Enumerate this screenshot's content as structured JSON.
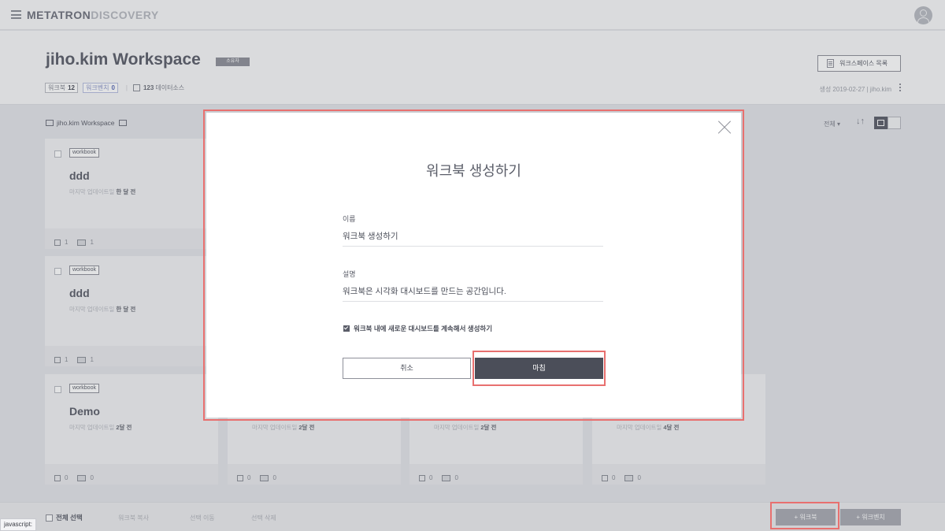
{
  "brand": {
    "main": "METATRON",
    "sub": "DISCOVERY"
  },
  "workspace": {
    "title": "jiho.kim Workspace",
    "owner_badge": "소유자",
    "workbook_label": "워크북",
    "workbook_count": "12",
    "workbench_label": "워크벤치",
    "workbench_count": "0",
    "datasource_count": "123",
    "datasource_label": "데이터소스",
    "list_button": "워크스페이스 목록",
    "created": "생성 2019-02-27 | jiho.kim"
  },
  "toolbar": {
    "breadcrumb": "jiho.kim Workspace",
    "filter": "전체",
    "filter_arrow": "▾",
    "sort_icon": "↓↑"
  },
  "cards": [
    {
      "tag": "workbook",
      "name": "ddd",
      "updated_label": "마지막 업데이트일",
      "updated_value": "한 달 전",
      "files": "1",
      "dashboards": "1"
    },
    {
      "tag": "workbook",
      "name": "ddd",
      "updated_label": "마지막 업데이트일",
      "updated_value": "한 달 전",
      "files": "1",
      "dashboards": "1"
    },
    {
      "tag": "workbook",
      "name": "Demo",
      "updated_label": "마지막 업데이트일",
      "updated_value": "2달 전",
      "files": "0",
      "dashboards": "0"
    },
    {
      "updated_label": "마지막 업데이트일",
      "updated_value": "2달 전",
      "files": "0",
      "dashboards": "0"
    },
    {
      "updated_label": "마지막 업데이트일",
      "updated_value": "2달 전",
      "files": "0",
      "dashboards": "0"
    },
    {
      "updated_label": "마지막 업데이트일",
      "updated_value": "4달 전",
      "files": "0",
      "dashboards": "0"
    }
  ],
  "bottom": {
    "select_all": "전체 선택",
    "copy": "워크북 복사",
    "move": "선택 이동",
    "delete": "선택 삭제",
    "add_workbook": "+ 워크북",
    "add_workbench": "+ 워크벤치"
  },
  "status_bar": "javascript:",
  "modal": {
    "title": "워크북 생성하기",
    "name_label": "이름",
    "name_value": "워크북 생성하기",
    "desc_label": "설명",
    "desc_value": "워크북은 시각화 대시보드를 만드는 공간입니다.",
    "checkbox_label": "워크북 내에 새로운 대시보드를 계속해서 생성하기",
    "checkbox_checked": true,
    "cancel": "취소",
    "done": "마침"
  }
}
